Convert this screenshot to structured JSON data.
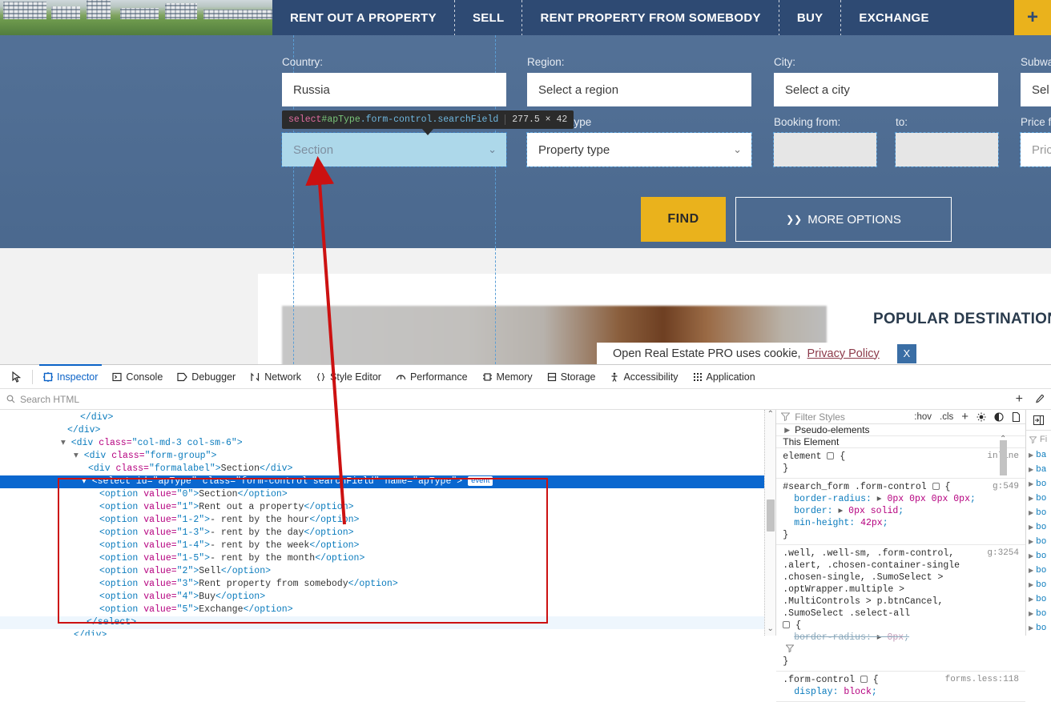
{
  "site": {
    "nav": [
      {
        "label": "RENT OUT A PROPERTY"
      },
      {
        "label": "SELL"
      },
      {
        "label": "RENT PROPERTY FROM SOMEBODY"
      },
      {
        "label": "BUY"
      },
      {
        "label": "EXCHANGE"
      }
    ],
    "add_button_label": "+",
    "search_form": {
      "country_label": "Country:",
      "country_value": "Russia",
      "region_label": "Region:",
      "region_value": "Select a region",
      "city_label": "City:",
      "city_value": "Select a city",
      "subway_label": "Subwa",
      "subway_value": "Sel",
      "section_label": "Section",
      "section_value": "Section",
      "property_type_label": "Property type",
      "property_type_value": "Property type",
      "booking_from_label": "Booking from:",
      "booking_from_value": "",
      "booking_to_label": "to:",
      "booking_to_value": "",
      "price_label": "Price f",
      "price_value": "Pric",
      "find_label": "FIND",
      "more_options_label": "MORE OPTIONS",
      "more_options_chevron": "chevron-double-down-icon"
    },
    "popular_destinations": "POPULAR DESTINATIONS",
    "cookie_bar": {
      "text": "Open Real Estate PRO uses cookie,",
      "link": "Privacy Policy",
      "close_label": "X"
    }
  },
  "inspector_tooltip": {
    "tag": "select",
    "id": "#apType",
    "classes": ".form-control.searchField",
    "dimensions": "277.5 × 42"
  },
  "devtools": {
    "tabs": [
      {
        "label": "Inspector",
        "icon": "inspector-icon",
        "active": true
      },
      {
        "label": "Console",
        "icon": "console-icon",
        "active": false
      },
      {
        "label": "Debugger",
        "icon": "debugger-icon",
        "active": false
      },
      {
        "label": "Network",
        "icon": "network-icon",
        "active": false
      },
      {
        "label": "Style Editor",
        "icon": "style-editor-icon",
        "active": false
      },
      {
        "label": "Performance",
        "icon": "performance-icon",
        "active": false
      },
      {
        "label": "Memory",
        "icon": "memory-icon",
        "active": false
      },
      {
        "label": "Storage",
        "icon": "storage-icon",
        "active": false
      },
      {
        "label": "Accessibility",
        "icon": "accessibility-icon",
        "active": false
      },
      {
        "label": "Application",
        "icon": "application-icon",
        "active": false
      }
    ],
    "search_placeholder": "Search HTML",
    "markup": {
      "lines": [
        {
          "indent": 4,
          "html": "close-div"
        },
        {
          "indent": 3,
          "html": "close-div"
        },
        {
          "indent": 2,
          "html": "div-col"
        },
        {
          "indent": 3,
          "html": "div-formgroup"
        },
        {
          "indent": 4,
          "html": "div-formalabel"
        },
        {
          "indent": 4,
          "html": "select-open",
          "selected": true
        },
        {
          "indent": 5,
          "html": "option0"
        },
        {
          "indent": 5,
          "html": "option1"
        },
        {
          "indent": 5,
          "html": "option12"
        },
        {
          "indent": 5,
          "html": "option13"
        },
        {
          "indent": 5,
          "html": "option14"
        },
        {
          "indent": 5,
          "html": "option15"
        },
        {
          "indent": 5,
          "html": "option2"
        },
        {
          "indent": 5,
          "html": "option3"
        },
        {
          "indent": 5,
          "html": "option4"
        },
        {
          "indent": 5,
          "html": "option5"
        },
        {
          "indent": 4,
          "html": "select-close"
        },
        {
          "indent": 3,
          "html": "close-div"
        }
      ],
      "text": {
        "col_class": "col-md-3 col-sm-6",
        "formgroup_class": "form-group",
        "formalabel_class": "formalabel",
        "formalabel_text": "Section",
        "select_id": "apType",
        "select_class": "form-control searchField",
        "select_name": "apType",
        "event_badge": "event",
        "options": [
          {
            "value": "0",
            "text": "Section"
          },
          {
            "value": "1",
            "text": "Rent out a property"
          },
          {
            "value": "1-2",
            "text": "- rent by the hour"
          },
          {
            "value": "1-3",
            "text": "- rent by the day"
          },
          {
            "value": "1-4",
            "text": "- rent by the week"
          },
          {
            "value": "1-5",
            "text": "- rent by the month"
          },
          {
            "value": "2",
            "text": "Sell"
          },
          {
            "value": "3",
            "text": "Rent property from somebody"
          },
          {
            "value": "4",
            "text": "Buy"
          },
          {
            "value": "5",
            "text": "Exchange"
          }
        ]
      }
    },
    "rules": {
      "filter_placeholder": "Filter Styles",
      "hov_label": ":hov",
      "cls_label": ".cls",
      "add_label": "+",
      "light_icon": "light-scheme-icon",
      "dark_icon": "dark-scheme-icon",
      "print_icon": "print-media-icon",
      "panel_toggle_icon": "panel-toggle-icon",
      "pseudo_elements": "Pseudo-elements",
      "this_element": "This Element",
      "entries": [
        {
          "selector": "element",
          "origin": "inline",
          "declarations": []
        },
        {
          "selector": "#search_form .form-control",
          "origin": "g:549",
          "declarations": [
            {
              "prop": "border-radius",
              "value": "0px 0px 0px 0px",
              "expandable": true
            },
            {
              "prop": "border",
              "value": "0px solid",
              "expandable": true
            },
            {
              "prop": "min-height",
              "value": "42px",
              "expandable": false
            }
          ]
        },
        {
          "selector": ".well, .well-sm, .form-control, .alert, .chosen-container-single .chosen-single, .SumoSelect > .optWrapper.multiple > .MultiControls > p.btnCancel, .SumoSelect .select-all",
          "origin": "g:3254",
          "declarations": [
            {
              "prop": "border-radius",
              "value": "0px",
              "expandable": true,
              "struck": true
            }
          ]
        },
        {
          "selector": ".form-control",
          "origin": "forms.less:118",
          "declarations": [
            {
              "prop": "display",
              "value": "block",
              "expandable": false
            }
          ]
        }
      ]
    },
    "computed": {
      "filter_label": "Fi",
      "rows": [
        "ba",
        "ba",
        "bo",
        "bo",
        "bo",
        "bo",
        "bo",
        "bo",
        "bo",
        "bo",
        "bo",
        "bo",
        "bo",
        "bo"
      ]
    }
  },
  "colors": {
    "band_blue": "#4d6c93",
    "navbar_blue": "#2e4a73",
    "accent_yellow": "#eab21c",
    "devtools_select_blue": "#0a67cf",
    "highlight_cyan": "#add8ea",
    "highlight_purple": "#c9a7e8",
    "annotation_red": "#cc1111"
  }
}
